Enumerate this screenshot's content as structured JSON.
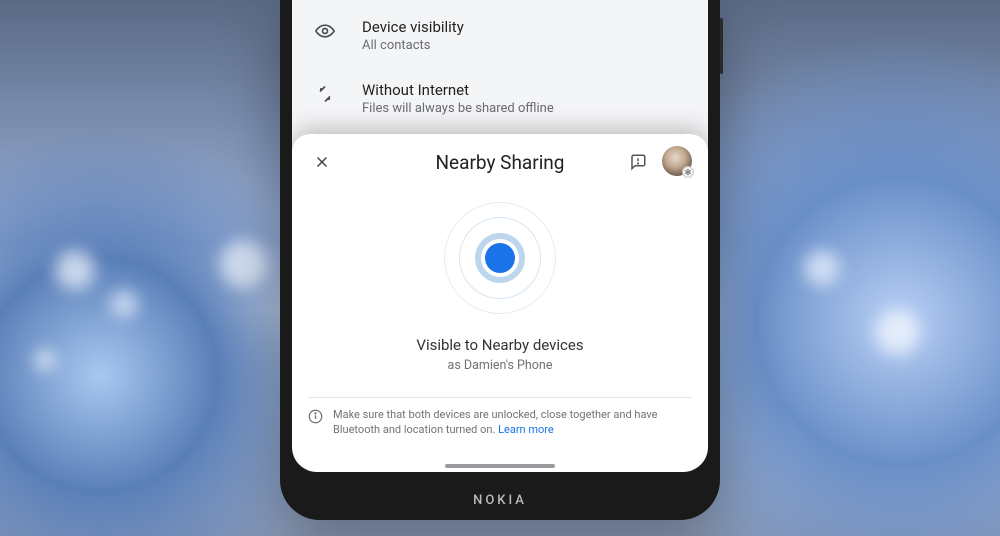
{
  "settings": {
    "rows": [
      {
        "title": "Device visibility",
        "subtitle": "All contacts"
      },
      {
        "title": "Without Internet",
        "subtitle": "Files will always be shared offline"
      }
    ]
  },
  "sheet": {
    "title": "Nearby Sharing",
    "visible_label": "Visible to Nearby devices",
    "device_label": "as Damien's Phone",
    "hint_text": "Make sure that both devices are unlocked, close together and have Bluetooth and location turned on. ",
    "learn_more": "Learn more"
  },
  "phone": {
    "brand": "NOKIA"
  }
}
